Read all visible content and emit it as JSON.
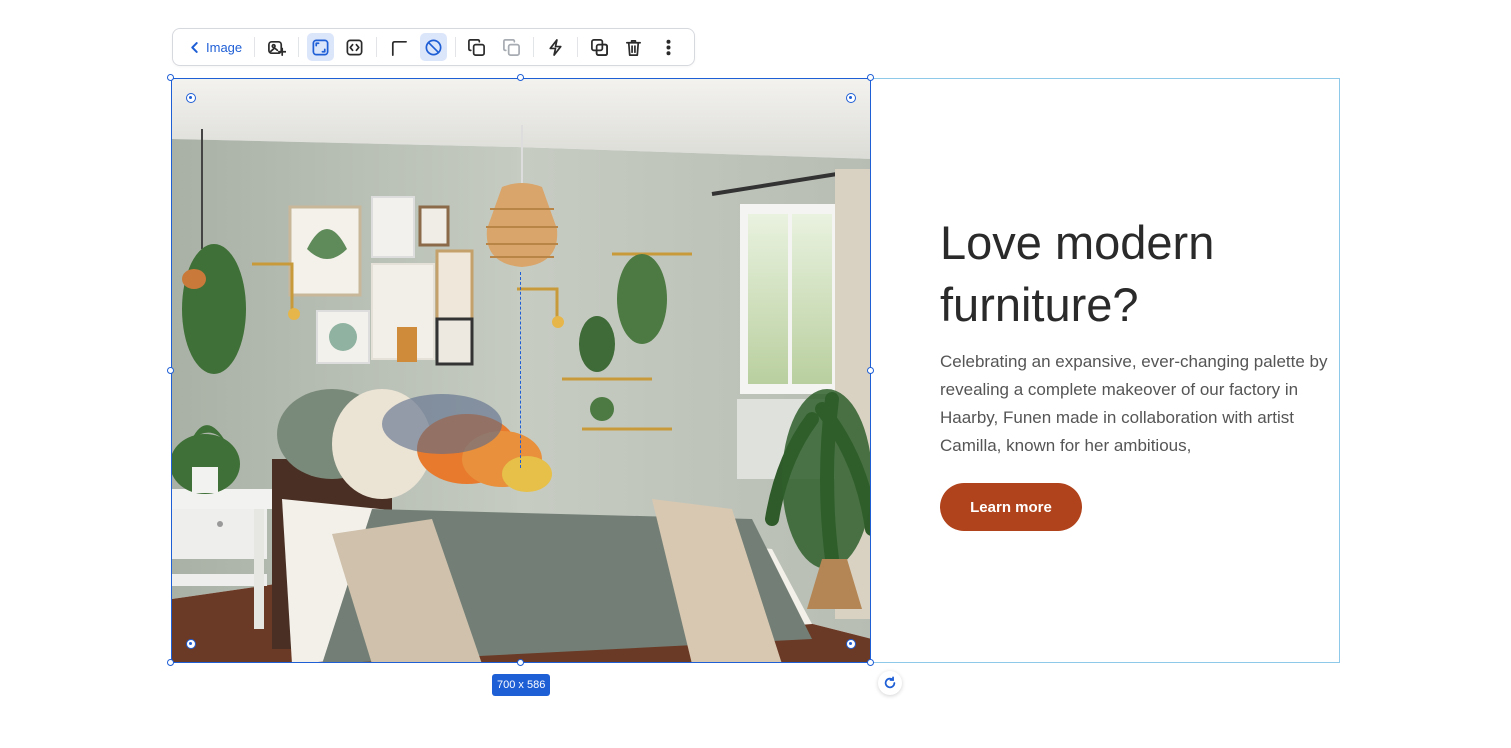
{
  "toolbar": {
    "back_label": "Image",
    "buttons": [
      {
        "icon": "image-replace-icon",
        "state": "normal"
      },
      {
        "icon": "fill-icon",
        "state": "active"
      },
      {
        "icon": "fit-icon",
        "state": "normal"
      },
      {
        "icon": "corner-radius-icon",
        "state": "normal"
      },
      {
        "icon": "no-border-icon",
        "state": "active"
      },
      {
        "icon": "duplicate-icon",
        "state": "normal"
      },
      {
        "icon": "copy-style-icon",
        "state": "disabled"
      },
      {
        "icon": "interaction-icon",
        "state": "normal"
      },
      {
        "icon": "layers-icon",
        "state": "normal"
      },
      {
        "icon": "trash-icon",
        "state": "normal"
      },
      {
        "icon": "more-vertical-icon",
        "state": "normal"
      }
    ]
  },
  "selection": {
    "size_label": "700 x 586"
  },
  "content": {
    "headline_line1": "Love modern",
    "headline_line2": "furniture?",
    "body": "Celebrating an expansive, ever-changing palette by revealing a complete makeover of our factory in Haarby, Funen made in collaboration with artist Camilla, known for her ambitious,",
    "cta_label": "Learn more"
  },
  "colors": {
    "accent": "#1f5fd6",
    "cta": "#b0431b",
    "frame_outline": "#8ec9ea"
  }
}
